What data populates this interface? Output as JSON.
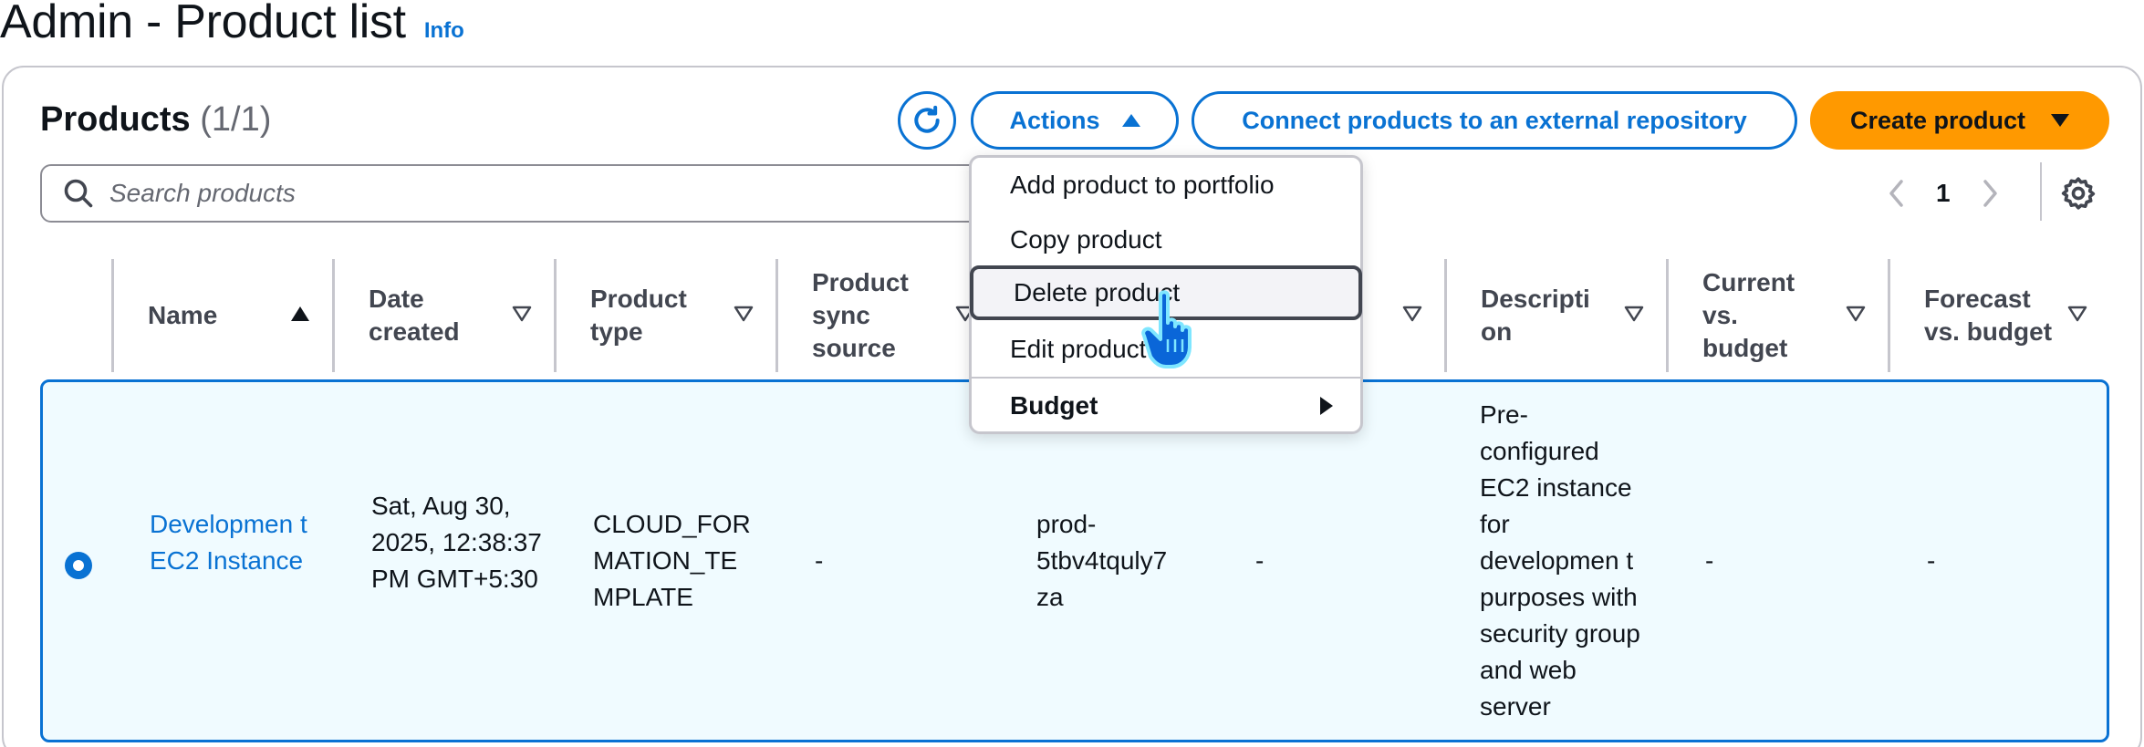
{
  "page": {
    "title": "Admin - Product list",
    "info_link": "Info"
  },
  "panel": {
    "title": "Products",
    "count": "(1/1)"
  },
  "toolbar": {
    "refresh_icon": "refresh-icon",
    "actions_label": "Actions",
    "connect_label": "Connect products to an external repository",
    "create_label": "Create product"
  },
  "search": {
    "placeholder": "Search products",
    "value": ""
  },
  "pagination": {
    "current_page": "1"
  },
  "actions_menu": {
    "items": [
      "Add product to portfolio",
      "Copy product",
      "Delete product",
      "Edit product"
    ],
    "hovered": "Delete product",
    "group": "Budget"
  },
  "table": {
    "columns": [
      {
        "label": "Name",
        "sort": "ascending"
      },
      {
        "label": "Date created",
        "sort": "none"
      },
      {
        "label": "Product type",
        "sort": "none"
      },
      {
        "label": "Product sync source",
        "sort": "none"
      },
      {
        "label": "",
        "sort": "none"
      },
      {
        "label": "",
        "sort": "none"
      },
      {
        "label": "Descripti on",
        "sort": "none"
      },
      {
        "label": "Current vs. budget",
        "sort": "none"
      },
      {
        "label": "Forecast vs. budget",
        "sort": "none"
      }
    ],
    "rows": [
      {
        "selected": true,
        "name": "Developmen t EC2 Instance",
        "date_created": "Sat, Aug 30, 2025, 12:38:37 PM GMT+5:30",
        "product_type": "CLOUD_FOR MATION_TE MPLATE",
        "sync_source": "-",
        "product_id": "prod- 5tbv4tquly7 za",
        "col6": "-",
        "description": "Pre- configured EC2 instance for developmen t purposes with security group and web server",
        "current_vs_budget": "-",
        "forecast_vs_budget": "-"
      }
    ]
  },
  "colors": {
    "accent": "#0972d3",
    "primary_button": "#ff9900",
    "selected_row_bg": "#f0fbff",
    "border": "#c6c6cd"
  }
}
